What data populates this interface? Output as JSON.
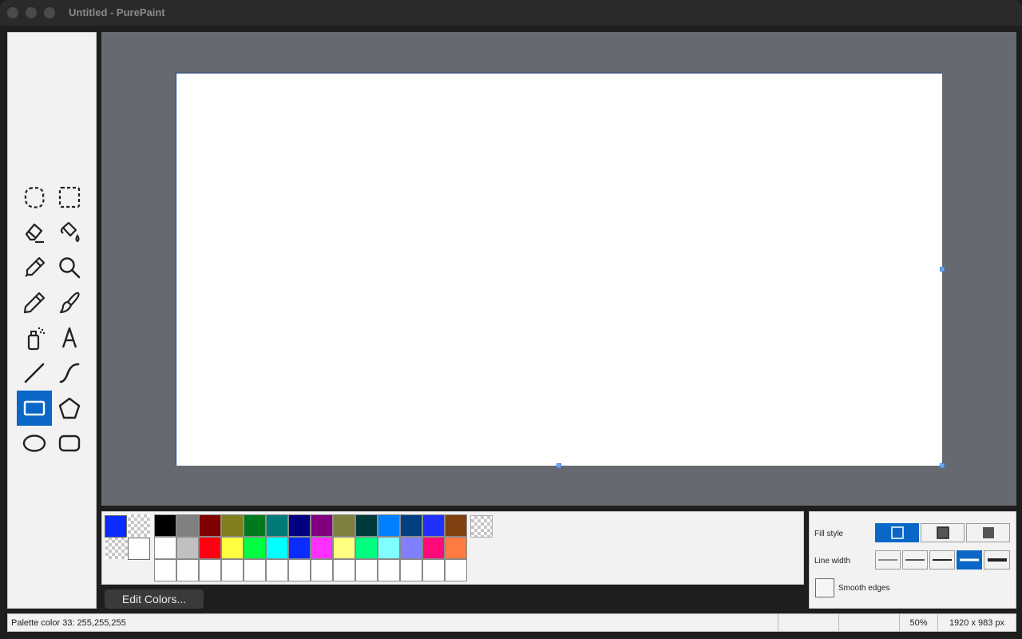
{
  "window": {
    "title": "Untitled - PurePaint"
  },
  "tools": [
    {
      "name": "free-form-select-tool",
      "icon": "freeform-select-icon",
      "selected": false
    },
    {
      "name": "rectangle-select-tool",
      "icon": "rect-select-icon",
      "selected": false
    },
    {
      "name": "eraser-tool",
      "icon": "eraser-icon",
      "selected": false
    },
    {
      "name": "fill-bucket-tool",
      "icon": "fill-bucket-icon",
      "selected": false
    },
    {
      "name": "color-picker-tool",
      "icon": "eyedropper-icon",
      "selected": false
    },
    {
      "name": "magnifier-tool",
      "icon": "magnifier-icon",
      "selected": false
    },
    {
      "name": "pencil-tool",
      "icon": "pencil-icon",
      "selected": false
    },
    {
      "name": "brush-tool",
      "icon": "brush-icon",
      "selected": false
    },
    {
      "name": "airbrush-tool",
      "icon": "airbrush-icon",
      "selected": false
    },
    {
      "name": "text-tool",
      "icon": "text-icon",
      "selected": false
    },
    {
      "name": "line-tool",
      "icon": "line-icon",
      "selected": false
    },
    {
      "name": "curve-tool",
      "icon": "curve-icon",
      "selected": false
    },
    {
      "name": "rectangle-tool",
      "icon": "rectangle-icon",
      "selected": true
    },
    {
      "name": "polygon-tool",
      "icon": "polygon-icon",
      "selected": false
    },
    {
      "name": "ellipse-tool",
      "icon": "ellipse-icon",
      "selected": false
    },
    {
      "name": "rounded-rectangle-tool",
      "icon": "rounded-rectangle-icon",
      "selected": false
    }
  ],
  "palette": {
    "primary_color": "#0a2cff",
    "secondary_color": "#ffffff",
    "row1": [
      "#000000",
      "#808080",
      "#800000",
      "#808020",
      "#007a1e",
      "#007a78",
      "#000080",
      "#800080",
      "#808040",
      "#003a3a",
      "#0080ff",
      "#004080",
      "#1f30ff",
      "#804010"
    ],
    "row2": [
      "#ffffff",
      "#c0c0c0",
      "#ff0012",
      "#ffff40",
      "#00ff40",
      "#00ffff",
      "#0a2cff",
      "#ff30ff",
      "#ffff80",
      "#00ff80",
      "#80ffff",
      "#8080ff",
      "#ff0a7a",
      "#ff7a40"
    ],
    "row3": [
      "#ffffff",
      "#ffffff",
      "#ffffff",
      "#ffffff",
      "#ffffff",
      "#ffffff",
      "#ffffff",
      "#ffffff",
      "#ffffff",
      "#ffffff",
      "#ffffff",
      "#ffffff",
      "#ffffff",
      "#ffffff"
    ],
    "edit_colors_label": "Edit Colors..."
  },
  "options": {
    "fill_style_label": "Fill style",
    "fill_style_selected_index": 0,
    "line_width_label": "Line width",
    "line_width_selected_index": 3,
    "smooth_edges_label": "Smooth edges",
    "smooth_edges_checked": false
  },
  "status": {
    "message": "Palette color 33: 255,255,255",
    "zoom": "50%",
    "size": "1920 x 983 px"
  }
}
